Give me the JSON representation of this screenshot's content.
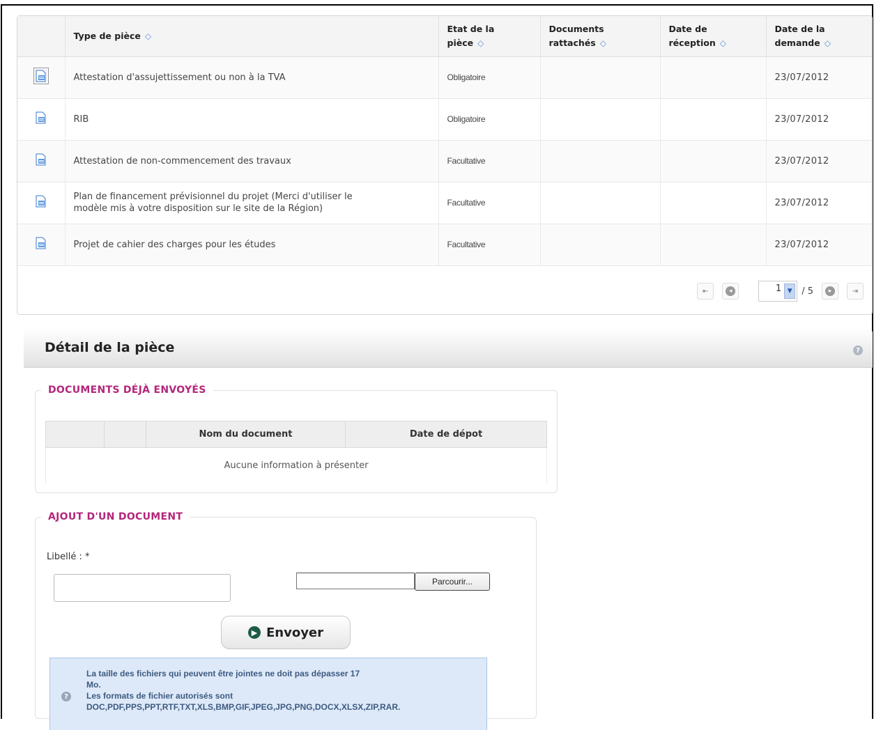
{
  "table": {
    "headers": {
      "type": "Type de pièce",
      "etat_l1": "Etat de la",
      "etat_l2": "pièce",
      "docs_l1": "Documents",
      "docs_l2": "rattachés",
      "reception_l1": "Date de",
      "reception_l2": "réception",
      "demande_l1": "Date de la",
      "demande_l2": "demande"
    },
    "rows": [
      {
        "type": "Attestation d'assujettissement ou non à la TVA",
        "etat": "Obligatoire",
        "docs": "",
        "reception": "",
        "demande": "23/07/2012"
      },
      {
        "type": "RIB",
        "etat": "Obligatoire",
        "docs": "",
        "reception": "",
        "demande": "23/07/2012"
      },
      {
        "type": "Attestation de non-commencement des travaux",
        "etat": "Facultative",
        "docs": "",
        "reception": "",
        "demande": "23/07/2012"
      },
      {
        "type_l1": "Plan de financement prévisionnel du projet (Merci d'utiliser le",
        "type_l2": "modèle mis à votre disposition sur le site de la Région)",
        "etat": "Facultative",
        "docs": "",
        "reception": "",
        "demande": "23/07/2012"
      },
      {
        "type": "Projet de cahier des charges pour les études",
        "etat": "Facultative",
        "docs": "",
        "reception": "",
        "demande": "23/07/2012"
      }
    ]
  },
  "pager": {
    "current_page": "1",
    "total": "/ 5"
  },
  "detail": {
    "title": "Détail de la pièce",
    "help": "?"
  },
  "sent": {
    "legend": "DOCUMENTS DÉJÀ ENVOYÉS",
    "col_name": "Nom du document",
    "col_date": "Date de dépot",
    "empty": "Aucune information à présenter"
  },
  "add": {
    "legend": "AJOUT D'UN DOCUMENT",
    "label": "Libellé : *",
    "label_value": "",
    "browse": "Parcourir...",
    "send": "Envoyer",
    "info_l1": "La taille des fichiers qui peuvent être jointes ne doit pas dépasser 17",
    "info_l2": "Mo.",
    "info_l3": "Les formats de fichier autorisés sont",
    "info_l4": "DOC,PDF,PPS,PPT,RTF,TXT,XLS,BMP,GIF,JPEG,JPG,PNG,DOCX,XLSX,ZIP,RAR."
  },
  "colors": {
    "legend": "#b3267a",
    "info_bg": "#dde9f8",
    "info_text": "#3d5a80",
    "send_arrow": "#1e5c46",
    "sort_icon": "#5a8fd6"
  }
}
